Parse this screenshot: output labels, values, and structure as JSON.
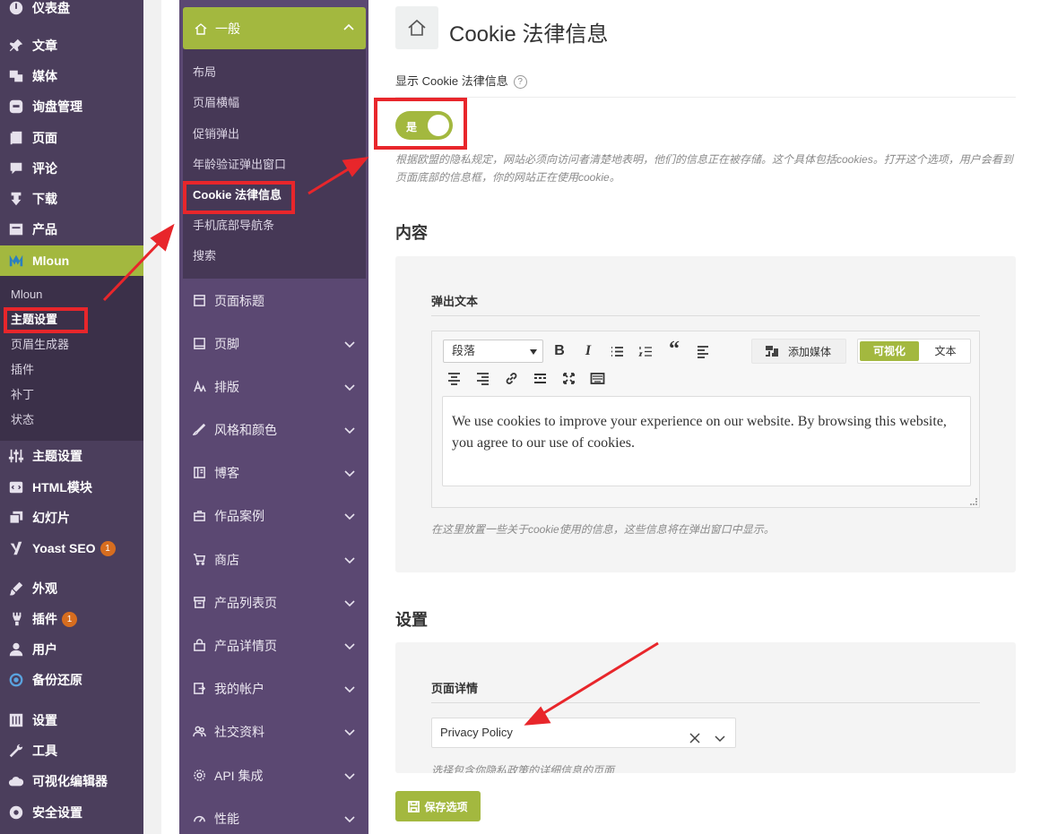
{
  "wp_menu": {
    "items": [
      {
        "label": "仪表盘",
        "icon": "dashboard-icon"
      },
      {
        "label": "文章",
        "icon": "pin-icon"
      },
      {
        "label": "媒体",
        "icon": "media-icon"
      },
      {
        "label": "询盘管理",
        "icon": "inquiry-icon"
      },
      {
        "label": "页面",
        "icon": "page-icon"
      },
      {
        "label": "评论",
        "icon": "comment-icon"
      },
      {
        "label": "下载",
        "icon": "download-icon"
      },
      {
        "label": "产品",
        "icon": "product-icon"
      },
      {
        "label": "Mloun",
        "icon": "mloun-logo-icon"
      },
      {
        "label": "主题设置",
        "icon": "sliders-icon"
      },
      {
        "label": "HTML模块",
        "icon": "html-icon"
      },
      {
        "label": "幻灯片",
        "icon": "slides-icon"
      },
      {
        "label": "Yoast SEO",
        "icon": "yoast-icon",
        "badge": "1"
      },
      {
        "label": "外观",
        "icon": "brush-icon"
      },
      {
        "label": "插件",
        "icon": "plugin-icon",
        "badge": "1"
      },
      {
        "label": "用户",
        "icon": "user-icon"
      },
      {
        "label": "备份还原",
        "icon": "backup-icon"
      },
      {
        "label": "设置",
        "icon": "settings-icon"
      },
      {
        "label": "工具",
        "icon": "wrench-icon"
      },
      {
        "label": "可视化编辑器",
        "icon": "cloud-icon"
      },
      {
        "label": "安全设置",
        "icon": "shield-icon"
      }
    ],
    "submenu": [
      "Mloun",
      "主题设置",
      "页眉生成器",
      "插件",
      "补丁",
      "状态"
    ]
  },
  "options_nav": {
    "general": {
      "label": "一般",
      "icon": "home-icon"
    },
    "general_sub": [
      "布局",
      "页眉横幅",
      "促销弹出",
      "年龄验证弹出窗口",
      "Cookie 法律信息",
      "手机底部导航条",
      "搜索"
    ],
    "sections": [
      {
        "label": "页面标题",
        "icon": "page-title-icon",
        "chevron": false
      },
      {
        "label": "页脚",
        "icon": "footer-icon",
        "chevron": true
      },
      {
        "label": "排版",
        "icon": "typography-icon",
        "chevron": true
      },
      {
        "label": "风格和颜色",
        "icon": "brush-icon",
        "chevron": true
      },
      {
        "label": "博客",
        "icon": "blog-icon",
        "chevron": true
      },
      {
        "label": "作品案例",
        "icon": "portfolio-icon",
        "chevron": true
      },
      {
        "label": "商店",
        "icon": "cart-icon",
        "chevron": true
      },
      {
        "label": "产品列表页",
        "icon": "archive-icon",
        "chevron": true
      },
      {
        "label": "产品详情页",
        "icon": "bag-icon",
        "chevron": true
      },
      {
        "label": "我的帐户",
        "icon": "account-icon",
        "chevron": true
      },
      {
        "label": "社交资料",
        "icon": "social-icon",
        "chevron": true
      },
      {
        "label": "API 集成",
        "icon": "gear-icon",
        "chevron": true
      },
      {
        "label": "性能",
        "icon": "gauge-icon",
        "chevron": true
      }
    ]
  },
  "main": {
    "title": "Cookie 法律信息",
    "show_label": "显示 Cookie 法律信息",
    "help": "?",
    "toggle_label": "是",
    "description": "根据欧盟的隐私规定，网站必须向访问者清楚地表明，他们的信息正在被存储。这个具体包括cookies。打开这个选项，用户会看到页面底部的信息框，你的网站正在使用cookie。",
    "content_heading": "内容",
    "popup_text_label": "弹出文本",
    "editor": {
      "format": "段落",
      "bold": "B",
      "italic": "I",
      "quote": "“",
      "add_media": "添加媒体",
      "tab_visual": "可视化",
      "tab_text": "文本",
      "body": "We use cookies to improve your experience on our website. By browsing this website, you agree to our use of cookies."
    },
    "popup_desc": "在这里放置一些关于cookie使用的信息，这些信息将在弹出窗口中显示。",
    "settings_heading": "设置",
    "page_details_label": "页面详情",
    "page_select_value": "Privacy Policy",
    "page_details_desc": "选择包含你隐私政策的详细信息的页面",
    "save_label": "保存选项"
  },
  "colors": {
    "accent": "#a3b83f",
    "wp_sidebar": "#4b3e5c",
    "options_nav": "#5b4872",
    "annotation_red": "#e8262b"
  }
}
